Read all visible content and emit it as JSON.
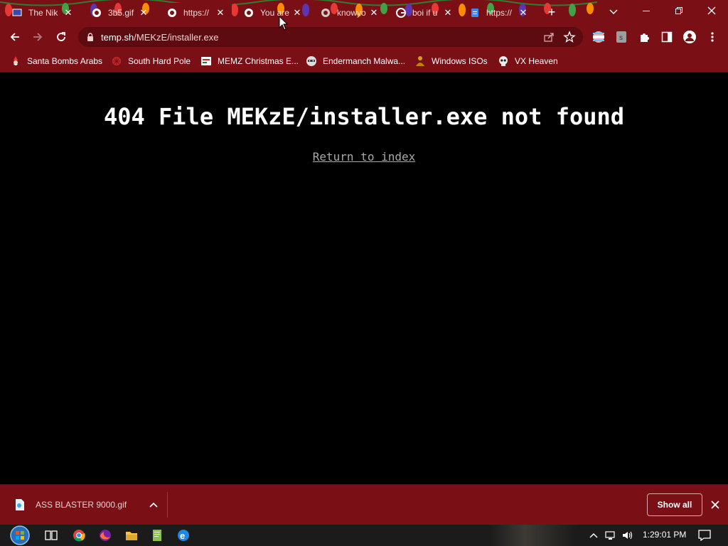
{
  "colors": {
    "theme": "#7a1016",
    "omnibox": "#5d0b10",
    "page_bg": "#000000",
    "error_text": "#ffffff",
    "link_text": "#a8a8a8",
    "taskbar": "#1b1b1b"
  },
  "tabs": [
    {
      "title": "The Nik",
      "favicon": "tv-icon",
      "active": false
    },
    {
      "title": "3b5.gif",
      "favicon": "globe-icon",
      "active": false
    },
    {
      "title": "https://",
      "favicon": "globe-icon",
      "active": true
    },
    {
      "title": "You are",
      "favicon": "globe-icon",
      "active": false
    },
    {
      "title": "knowyo",
      "favicon": "globe-icon",
      "active": false
    },
    {
      "title": "boi if u",
      "favicon": "google-icon",
      "active": false
    },
    {
      "title": "https://",
      "favicon": "google-docs-icon",
      "active": false
    }
  ],
  "toolbar": {
    "url_host": "temp.sh",
    "url_path": "/MEKzE/installer.exe"
  },
  "bookmarks": [
    {
      "label": "Santa Bombs Arabs",
      "icon": "santa-icon"
    },
    {
      "label": "South Hard Pole",
      "icon": "snowflake-icon"
    },
    {
      "label": "MEMZ Christmas E...",
      "icon": "memz-icon"
    },
    {
      "label": "Endermanch Malwa...",
      "icon": "raccoon-icon"
    },
    {
      "label": "Windows ISOs",
      "icon": "buddha-icon"
    },
    {
      "label": "VX Heaven",
      "icon": "skull-icon"
    }
  ],
  "page": {
    "title": "404 File MEKzE/installer.exe not found",
    "link": "Return to index"
  },
  "downloads": {
    "file_name": "ASS BLASTER 9000.gif",
    "show_all": "Show all"
  },
  "taskbar": {
    "time": "1:29:01 PM",
    "apps": [
      "start-orb-icon",
      "task-view-icon",
      "chrome-icon",
      "firefox-icon",
      "file-explorer-icon",
      "notepad-icon",
      "edge-icon"
    ]
  }
}
